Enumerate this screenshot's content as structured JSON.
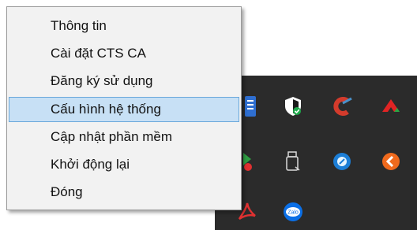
{
  "context_menu": {
    "items": [
      {
        "label": "Thông tin"
      },
      {
        "label": "Cài đặt CTS CA"
      },
      {
        "label": "Đăng ký sử dụng"
      },
      {
        "label": "Cấu hình hệ thống",
        "highlighted": true
      },
      {
        "label": "Cập nhật phần mềm"
      },
      {
        "label": "Khởi động lại"
      },
      {
        "label": "Đóng"
      }
    ]
  },
  "tray": {
    "icons": [
      {
        "name": "document-app-icon"
      },
      {
        "name": "windows-security-icon"
      },
      {
        "name": "ccleaner-icon"
      },
      {
        "name": "red-arrow-app-icon"
      },
      {
        "name": "green-red-app-icon"
      },
      {
        "name": "usb-drive-icon"
      },
      {
        "name": "blue-circle-app-icon"
      },
      {
        "name": "orange-circle-app-icon"
      },
      {
        "name": "acrobat-icon"
      },
      {
        "name": "zalo-icon",
        "text": "Zalo"
      }
    ]
  },
  "colors": {
    "menu_background": "#f2f2f2",
    "menu_highlight": "#c7e0f5",
    "menu_highlight_border": "#6aa8db",
    "tray_background": "#2b2b2b"
  }
}
